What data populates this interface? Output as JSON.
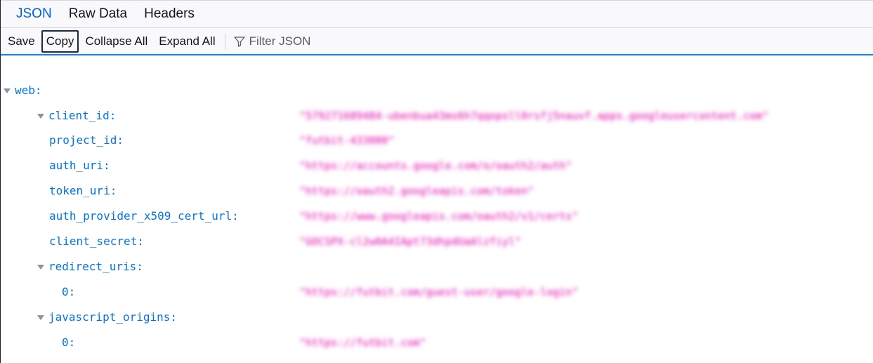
{
  "tabs": {
    "json": "JSON",
    "raw": "Raw Data",
    "headers": "Headers"
  },
  "toolbar": {
    "save": "Save",
    "copy": "Copy",
    "collapse_all": "Collapse All",
    "expand_all": "Expand All",
    "filter_placeholder": "Filter JSON"
  },
  "tree": {
    "web": "web:",
    "client_id": "client_id:",
    "client_id_value": "\"579271689484-ubenbua43ms6h7qqopsll0rsfj5nauvf.apps.googleusercontent.com\"",
    "project_id": "project_id:",
    "project_id_value": "\"futbit-433000\"",
    "auth_uri": "auth_uri:",
    "auth_uri_value": "\"https://accounts.google.com/o/oauth2/auth\"",
    "token_uri": "token_uri:",
    "token_uri_value": "\"https://oauth2.googleapis.com/token\"",
    "auth_provider": "auth_provider_x509_cert_url:",
    "auth_provider_value": "\"https://www.googleapis.com/oauth2/v1/certs\"",
    "client_secret": "client_secret:",
    "client_secret_value": "\"GOCSPX-cl2w0A4IApt73dhpdUaAlzfiyl\"",
    "redirect_uris": "redirect_uris:",
    "redirect_0": "0:",
    "redirect_0_value": "\"https://futbit.com/guest-user/google-login\"",
    "javascript_origins": "javascript_origins:",
    "origins_0": "0:",
    "origins_0_value": "\"https://futbit.com\""
  }
}
